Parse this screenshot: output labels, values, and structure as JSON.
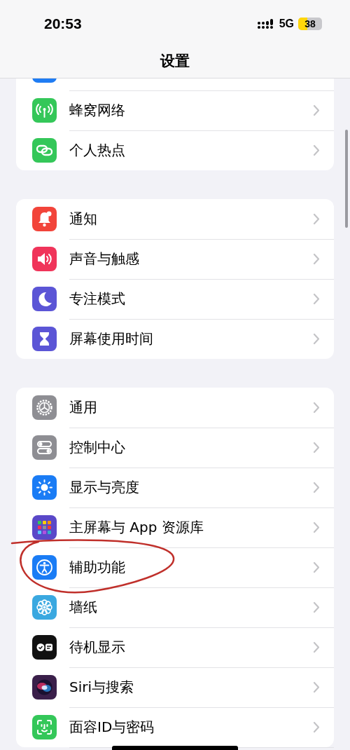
{
  "status_bar": {
    "time": "20:53",
    "network": "5G",
    "battery": "38"
  },
  "nav": {
    "title": "设置"
  },
  "groups": [
    {
      "items": [
        {
          "kind": "cut",
          "color": "#1f7cf3"
        },
        {
          "kind": "cellular",
          "color": "#34c759",
          "label": "蜂窝网络",
          "circled": false
        },
        {
          "kind": "hotspot",
          "color": "#34c759",
          "label": "个人热点",
          "circled": false
        }
      ]
    },
    {
      "items": [
        {
          "kind": "notifications",
          "color": "#f2443a",
          "label": "通知",
          "circled": false
        },
        {
          "kind": "sounds",
          "color": "#f0345a",
          "label": "声音与触感",
          "circled": false
        },
        {
          "kind": "focus",
          "color": "#5b55d6",
          "label": "专注模式",
          "circled": false
        },
        {
          "kind": "screentime",
          "color": "#5b55d6",
          "label": "屏幕使用时间",
          "circled": false
        }
      ]
    },
    {
      "items": [
        {
          "kind": "general",
          "color": "#8e8e93",
          "label": "通用",
          "circled": false
        },
        {
          "kind": "control",
          "color": "#8e8e93",
          "label": "控制中心",
          "circled": false
        },
        {
          "kind": "display",
          "color": "#1a7cf5",
          "label": "显示与亮度",
          "circled": false
        },
        {
          "kind": "homescreen",
          "color": "#5a48c8",
          "label": "主屏幕与 App 资源库",
          "circled": false
        },
        {
          "kind": "accessibility",
          "color": "#1a7cf5",
          "label": "辅助功能",
          "circled": true
        },
        {
          "kind": "wallpaper",
          "color": "#3aa8e0",
          "label": "墙纸",
          "circled": false
        },
        {
          "kind": "standby",
          "color": "#111111",
          "label": "待机显示",
          "circled": false
        },
        {
          "kind": "siri",
          "color": "#3a1f4a",
          "label": "Siri与搜索",
          "circled": false
        },
        {
          "kind": "faceid",
          "color": "#34c759",
          "label": "面容ID与密码",
          "circled": false
        }
      ]
    }
  ]
}
